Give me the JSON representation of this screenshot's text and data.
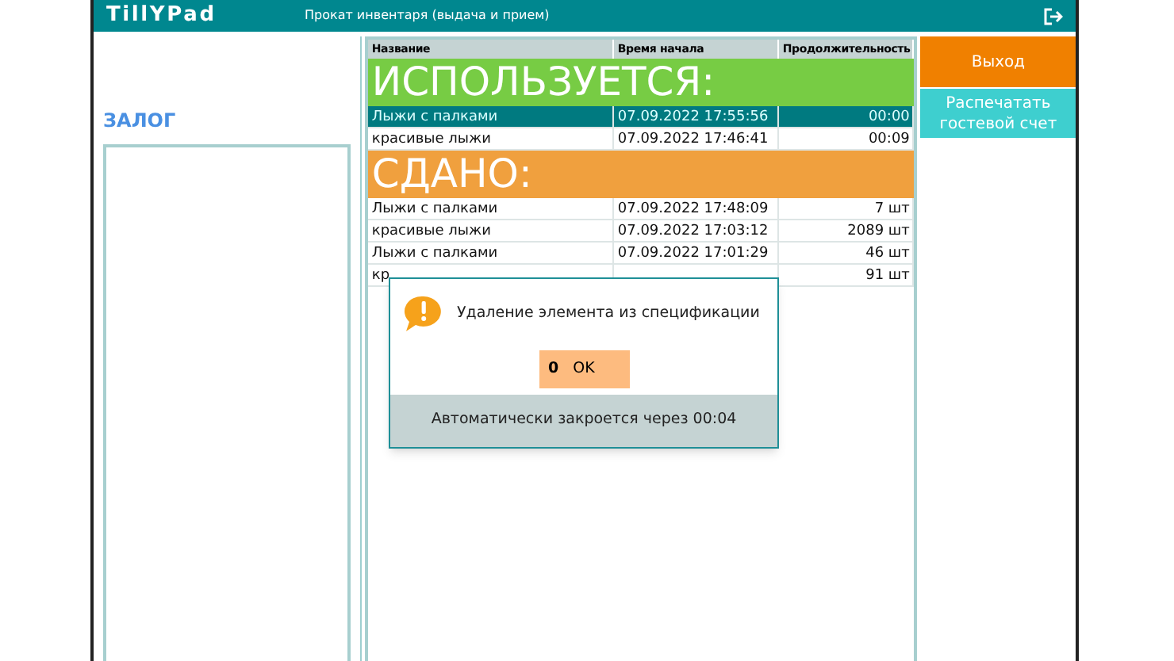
{
  "header": {
    "logo": "TillYPad",
    "title": "Прокат инвентаря (выдача и прием)"
  },
  "left_panel": {
    "title": "ЗАЛОГ"
  },
  "table": {
    "columns": [
      "Название",
      "Время начала",
      "Продолжительность"
    ],
    "sections": [
      {
        "kind": "in_use",
        "title": "ИСПОЛЬЗУЕТСЯ:",
        "rows": [
          {
            "name": "Лыжи с палками",
            "start": "07.09.2022 17:55:56",
            "duration": "00:00",
            "selected": true
          },
          {
            "name": "красивые лыжи",
            "start": "07.09.2022 17:46:41",
            "duration": "00:09",
            "selected": false
          }
        ]
      },
      {
        "kind": "returned",
        "title": "СДАНО:",
        "rows": [
          {
            "name": "Лыжи с палками",
            "start": "07.09.2022 17:48:09",
            "duration": "7 шт",
            "selected": false
          },
          {
            "name": "красивые лыжи",
            "start": "07.09.2022 17:03:12",
            "duration": "2089 шт",
            "selected": false
          },
          {
            "name": "Лыжи с палками",
            "start": "07.09.2022 17:01:29",
            "duration": "46 шт",
            "selected": false
          },
          {
            "name": "кр",
            "duration": "91 шт",
            "selected": false
          }
        ]
      }
    ]
  },
  "actions": [
    {
      "kind": "exit",
      "label": "Выход"
    },
    {
      "kind": "print",
      "label": "Распечатать гостевой счет"
    }
  ],
  "dialog": {
    "message": "Удаление элемента из спецификации",
    "button": {
      "hotkey": "0",
      "label": "OK"
    },
    "footer": "Автоматически закроется через 00:04"
  }
}
